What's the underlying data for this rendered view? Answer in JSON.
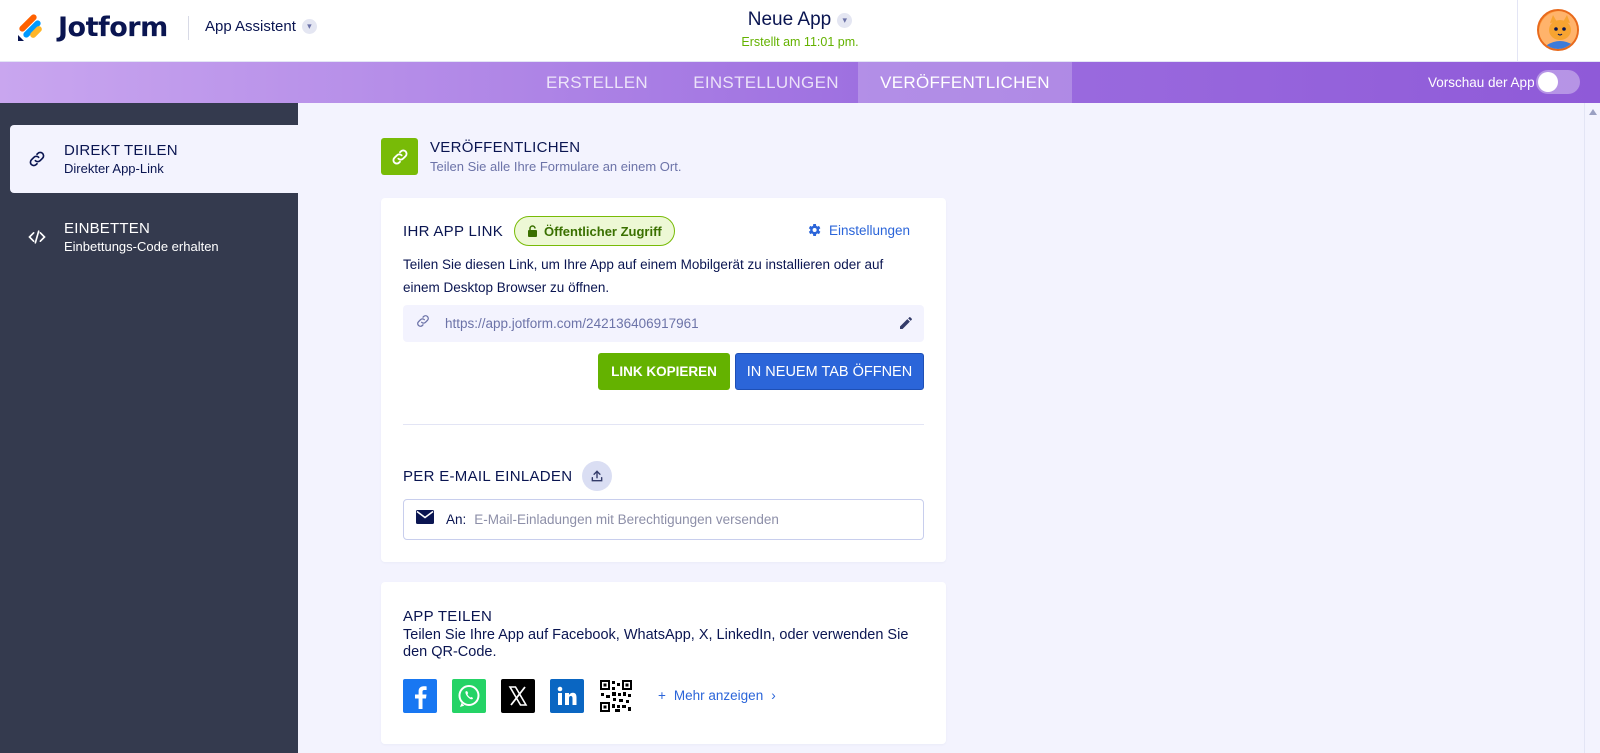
{
  "brand": {
    "name": "Jotform",
    "colors": {
      "orange": "#ff6100",
      "blue": "#0099ff",
      "yellow": "#ffb629",
      "navy": "#0a1551"
    }
  },
  "header": {
    "assistant_label": "App Assistent",
    "app_title": "Neue App",
    "app_subtitle": "Erstellt am 11:01 pm."
  },
  "nav": {
    "tabs": [
      {
        "label": "ERSTELLEN",
        "active": false
      },
      {
        "label": "EINSTELLUNGEN",
        "active": false
      },
      {
        "label": "VERÖFFENTLICHEN",
        "active": true
      }
    ],
    "preview_label": "Vorschau der App",
    "preview_enabled": false
  },
  "sidebar": {
    "items": [
      {
        "title": "DIREKT TEILEN",
        "subtitle": "Direkter App-Link",
        "icon": "link-icon",
        "active": true
      },
      {
        "title": "EINBETTEN",
        "subtitle": "Einbettungs-Code erhalten",
        "icon": "code-icon",
        "active": false
      }
    ]
  },
  "publish": {
    "title": "VERÖFFENTLICHEN",
    "subtitle": "Teilen Sie alle Ihre Formulare an einem Ort."
  },
  "app_link": {
    "title": "IHR APP LINK",
    "badge": "Öffentlicher Zugriff",
    "settings_label": "Einstellungen",
    "description": "Teilen Sie diesen Link, um Ihre App auf einem Mobilgerät zu installieren oder auf einem Desktop Browser zu öffnen.",
    "url": "https://app.jotform.com/242136406917961",
    "copy_label": "LINK KOPIEREN",
    "open_label": "IN NEUEM TAB ÖFFNEN"
  },
  "email": {
    "title": "PER E-MAIL EINLADEN",
    "to_label": "An:",
    "placeholder": "E-Mail-Einladungen mit Berechtigungen versenden"
  },
  "share": {
    "title": "APP TEILEN",
    "description": "Teilen Sie Ihre App auf Facebook, WhatsApp, X, LinkedIn, oder verwenden Sie den QR-Code.",
    "networks": [
      "facebook-icon",
      "whatsapp-icon",
      "x-icon",
      "linkedin-icon",
      "qr-code-icon"
    ],
    "more_label": "Mehr anzeigen"
  }
}
